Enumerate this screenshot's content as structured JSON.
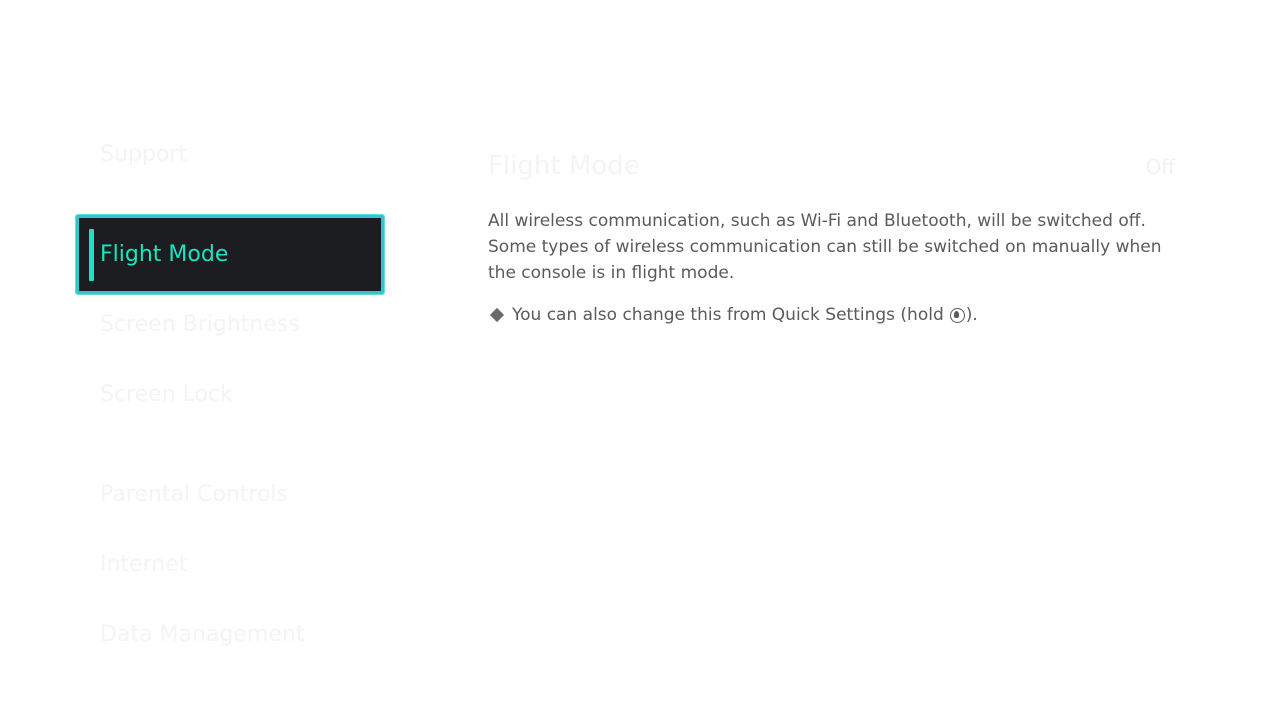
{
  "sidebar": {
    "items": [
      {
        "label": "Support",
        "selected": false
      },
      {
        "label": "Flight Mode",
        "selected": true
      },
      {
        "label": "Screen Brightness",
        "selected": false
      },
      {
        "label": "Screen Lock",
        "selected": false
      },
      {
        "label": "Parental Controls",
        "selected": false
      },
      {
        "label": "Internet",
        "selected": false
      },
      {
        "label": "Data Management",
        "selected": false
      }
    ]
  },
  "detail": {
    "title": "Flight Mode",
    "value": "Off",
    "description": "All wireless communication, such as Wi-Fi and Bluetooth, will be switched off. Some types of wireless communication can still be switched on manually when the console is in flight mode.",
    "note_before": "You can also change this from Quick Settings (hold",
    "note_after": ").",
    "note_icon": "home-button-icon"
  },
  "colors": {
    "accent": "#19e6c1",
    "selection_border": "#37c4c8",
    "selection_bg": "#1b1d20",
    "body_text": "#5a5a5a"
  }
}
